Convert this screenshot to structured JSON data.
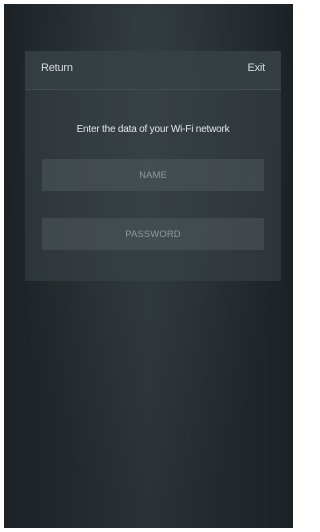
{
  "header": {
    "return_label": "Return",
    "exit_label": "Exit"
  },
  "form": {
    "prompt": "Enter the data of your Wi-Fi network",
    "name_placeholder": "NAME",
    "name_value": "",
    "password_placeholder": "PASSWORD",
    "password_value": ""
  }
}
